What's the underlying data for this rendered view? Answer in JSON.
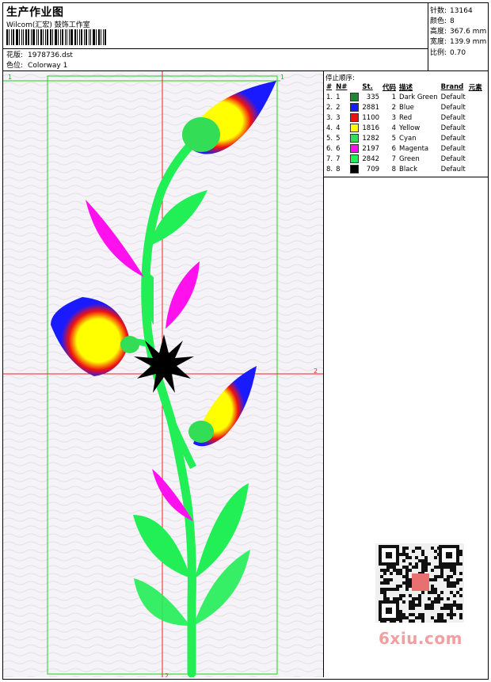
{
  "header": {
    "title": "生产作业图",
    "company": "Wilcom(汇宏) 鼓饰工作室",
    "design_label": "花版:",
    "design_value": "1978736.dst",
    "colorway_label": "色位:",
    "colorway_value": "Colorway 1"
  },
  "specs": [
    {
      "label": "针数:",
      "value": "13164"
    },
    {
      "label": "颜色:",
      "value": "8"
    },
    {
      "label": "高度:",
      "value": "367.6 mm"
    },
    {
      "label": "宽度:",
      "value": "139.9 mm"
    },
    {
      "label": "比例:",
      "value": "0.70"
    }
  ],
  "legend": {
    "heading": "停止顺序:",
    "columns": [
      "#",
      "N#",
      "St.",
      "代码",
      "描述",
      "Brand",
      "元素"
    ],
    "rows": [
      {
        "idx": "1.",
        "n": "1",
        "color": "#1a8a2a",
        "st": "335",
        "code": "1",
        "desc": "Dark Green",
        "brand": "Default"
      },
      {
        "idx": "2.",
        "n": "2",
        "color": "#1a1aff",
        "st": "2881",
        "code": "2",
        "desc": "Blue",
        "brand": "Default"
      },
      {
        "idx": "3.",
        "n": "3",
        "color": "#ee1111",
        "st": "1100",
        "code": "3",
        "desc": "Red",
        "brand": "Default"
      },
      {
        "idx": "4.",
        "n": "4",
        "color": "#ffff00",
        "st": "1816",
        "code": "4",
        "desc": "Yellow",
        "brand": "Default"
      },
      {
        "idx": "5.",
        "n": "5",
        "color": "#33dd55",
        "st": "1282",
        "code": "5",
        "desc": "Cyan",
        "brand": "Default"
      },
      {
        "idx": "6.",
        "n": "6",
        "color": "#ff11ee",
        "st": "2197",
        "code": "6",
        "desc": "Magenta",
        "brand": "Default"
      },
      {
        "idx": "7.",
        "n": "7",
        "color": "#22ee55",
        "st": "2842",
        "code": "7",
        "desc": "Green",
        "brand": "Default"
      },
      {
        "idx": "8.",
        "n": "8",
        "color": "#000000",
        "st": "709",
        "code": "8",
        "desc": "Black",
        "brand": "Default"
      }
    ]
  },
  "guides": {
    "top_label": "1",
    "right_label": "2",
    "bottom_label": "2"
  },
  "watermark": "6xiu.com"
}
